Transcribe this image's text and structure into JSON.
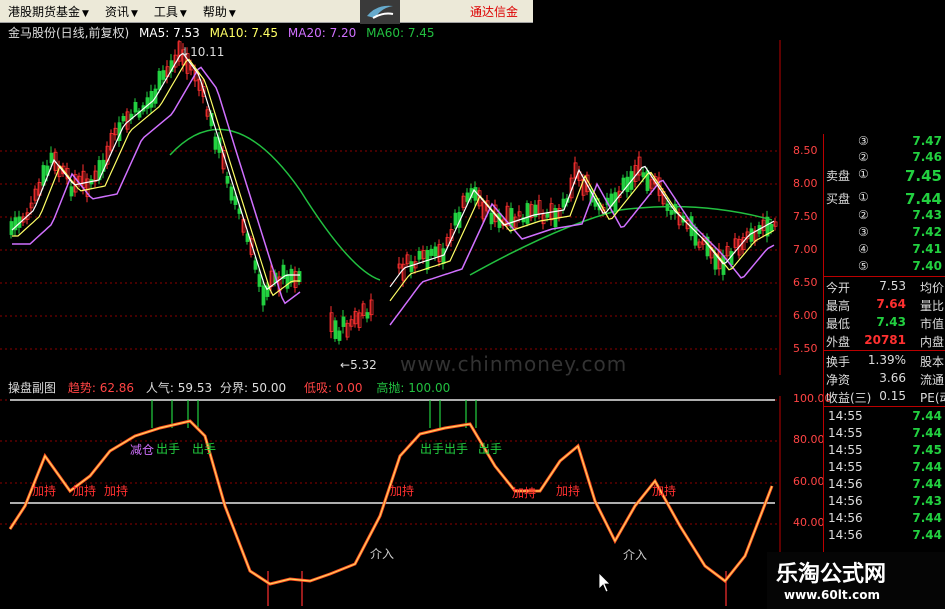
{
  "menu": {
    "items": [
      {
        "label": "港股期货基金",
        "arrow": "▼"
      },
      {
        "label": "资讯",
        "arrow": "▼"
      },
      {
        "label": "工具",
        "arrow": "▼"
      },
      {
        "label": "帮助",
        "arrow": "▼"
      }
    ],
    "broker": "通达信金"
  },
  "chart_header": {
    "name": "金马股份(日线,前复权)",
    "ma5": "MA5: 7.53",
    "ma10": "MA10: 7.45",
    "ma20": "MA20: 7.20",
    "ma60": "MA60: 7.45"
  },
  "price_axis": [
    "8.50",
    "8.00",
    "7.50",
    "7.00",
    "6.50",
    "6.00",
    "5.50"
  ],
  "price_marks": {
    "high": "10.11",
    "low": "5.32"
  },
  "watermark": "www.chinmoney.com",
  "sub_header": {
    "name": "操盘副图",
    "trend": "趋势: 62.86",
    "popularity": "人气: 59.53",
    "boundary": "分界: 50.00",
    "low_buy": "低吸: 0.00",
    "high_throw": "高抛: 100.00"
  },
  "sub_axis": [
    "100.00",
    "80.00",
    "60.00",
    "40.00"
  ],
  "sub_annotations": {
    "hold": "加持",
    "sell": "出手",
    "reduce": "减仓",
    "enter": "介入"
  },
  "quote": {
    "sell_label": "卖盘",
    "buy_label": "买盘",
    "sells": [
      {
        "level": "③",
        "price": "7.47"
      },
      {
        "level": "②",
        "price": "7.46"
      },
      {
        "level": "①",
        "price": "7.45"
      }
    ],
    "buys": [
      {
        "level": "①",
        "price": "7.44"
      },
      {
        "level": "②",
        "price": "7.43"
      },
      {
        "level": "③",
        "price": "7.42"
      },
      {
        "level": "④",
        "price": "7.41"
      },
      {
        "level": "⑤",
        "price": "7.40"
      }
    ],
    "stats": [
      {
        "label": "今开",
        "value": "7.53",
        "extra": "均价"
      },
      {
        "label": "最高",
        "value": "7.64",
        "extra": "量比"
      },
      {
        "label": "最低",
        "value": "7.43",
        "extra": "市值"
      },
      {
        "label": "外盘",
        "value": "20781",
        "extra": "内盘"
      },
      {
        "label": "换手",
        "value": "1.39%",
        "extra": "股本"
      },
      {
        "label": "净资",
        "value": "3.66",
        "extra": "流通"
      },
      {
        "label": "收益(三)",
        "value": "0.15",
        "extra": "PE(动"
      }
    ],
    "ticks": [
      {
        "time": "14:55",
        "price": "7.44"
      },
      {
        "time": "14:55",
        "price": "7.44"
      },
      {
        "time": "14:55",
        "price": "7.45"
      },
      {
        "time": "14:55",
        "price": "7.44"
      },
      {
        "time": "14:56",
        "price": "7.44"
      },
      {
        "time": "14:56",
        "price": "7.43"
      },
      {
        "time": "14:56",
        "price": "7.44"
      },
      {
        "time": "14:56",
        "price": "7.44"
      }
    ]
  },
  "colors": {
    "ma5": "#ffffff",
    "ma10": "#ffff66",
    "ma20": "#d070ff",
    "ma60": "#22c040",
    "grid": "#8b0000",
    "osc": "#ffb030",
    "up": "#ff3030",
    "down": "#22d040"
  },
  "site_watermark": {
    "title": "乐淘公式网",
    "url": "www.60lt.com"
  }
}
